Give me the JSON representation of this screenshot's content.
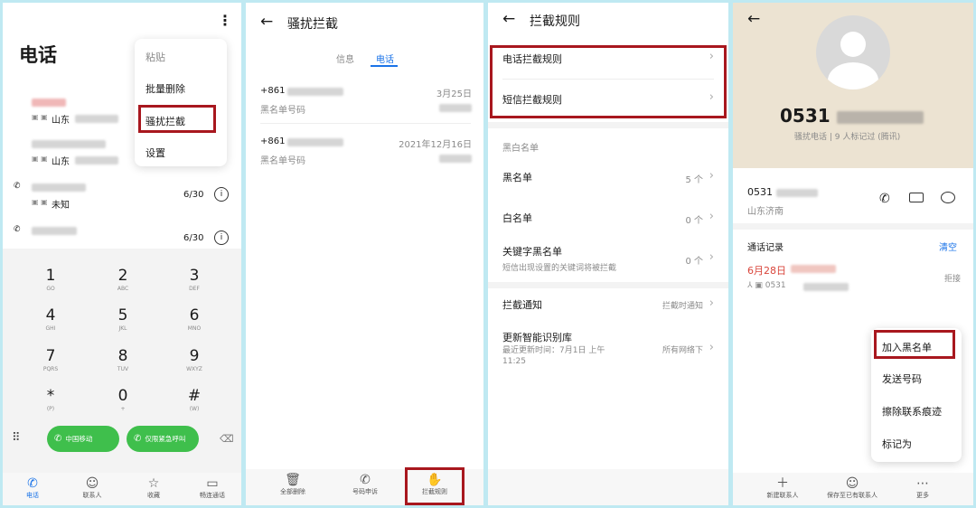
{
  "panel1": {
    "title": "电话",
    "more_icon": "more-vertical-icon",
    "menu": [
      "粘贴",
      "批量删除",
      "骚扰拦截",
      "设置"
    ],
    "calls": [
      {
        "sub": "山东",
        "count": ""
      },
      {
        "sub": "山东",
        "count": ""
      },
      {
        "sub": "未知",
        "count": "6/30"
      },
      {
        "sub": "",
        "count": "6/30"
      }
    ],
    "keys": [
      {
        "n": "1",
        "l": "GO"
      },
      {
        "n": "2",
        "l": "ABC"
      },
      {
        "n": "3",
        "l": "DEF"
      },
      {
        "n": "4",
        "l": "GHI"
      },
      {
        "n": "5",
        "l": "JKL"
      },
      {
        "n": "6",
        "l": "MNO"
      },
      {
        "n": "7",
        "l": "PQRS"
      },
      {
        "n": "8",
        "l": "TUV"
      },
      {
        "n": "9",
        "l": "WXYZ"
      },
      {
        "n": "*",
        "l": "(P)"
      },
      {
        "n": "0",
        "l": "+"
      },
      {
        "n": "#",
        "l": "(W)"
      }
    ],
    "call_buttons": [
      "中国移动",
      "仅限紧急呼叫"
    ],
    "nav": [
      "电话",
      "联系人",
      "收藏",
      "畅连通话"
    ],
    "colors": {
      "accent": "#1a73e8",
      "call_green": "#3fbf4c",
      "highlight": "#a8171e"
    }
  },
  "panel2": {
    "title": "骚扰拦截",
    "tabs": [
      "信息",
      "电话"
    ],
    "items": [
      {
        "number": "+861",
        "date": "3月25日",
        "sub": "黑名单号码"
      },
      {
        "number": "+861",
        "date": "2021年12月16日",
        "sub": "黑名单号码"
      }
    ],
    "bottom": [
      "全部删除",
      "号码申诉",
      "拦截规则"
    ]
  },
  "panel3": {
    "title": "拦截规则",
    "rules": [
      "电话拦截规则",
      "短信拦截规则"
    ],
    "section": "黑白名单",
    "lists": [
      {
        "label": "黑名单",
        "value": "5 个"
      },
      {
        "label": "白名单",
        "value": "0 个"
      },
      {
        "label": "关键字黑名单",
        "sub": "短信出现设置的关键词将被拦截",
        "value": "0 个"
      }
    ],
    "notify": {
      "label": "拦截通知",
      "value": "拦截时通知"
    },
    "update": {
      "label": "更新智能识别库",
      "sub": "最近更新时间：7月1日 上午 11:25",
      "value": "所有网络下"
    }
  },
  "panel4": {
    "number_prefix": "0531",
    "tag": "骚扰电话 | 9 人标记过 (腾讯)",
    "contact": {
      "number_prefix": "0531",
      "location": "山东济南"
    },
    "records_label": "通话记录",
    "clear": "清空",
    "record": {
      "date": "6月28日",
      "number_prefix": "0531",
      "status": "拒接"
    },
    "menu": [
      "加入黑名单",
      "发送号码",
      "擦除联系痕迹",
      "标记为"
    ],
    "bottom": [
      "新建联系人",
      "保存至已有联系人",
      "更多"
    ]
  }
}
